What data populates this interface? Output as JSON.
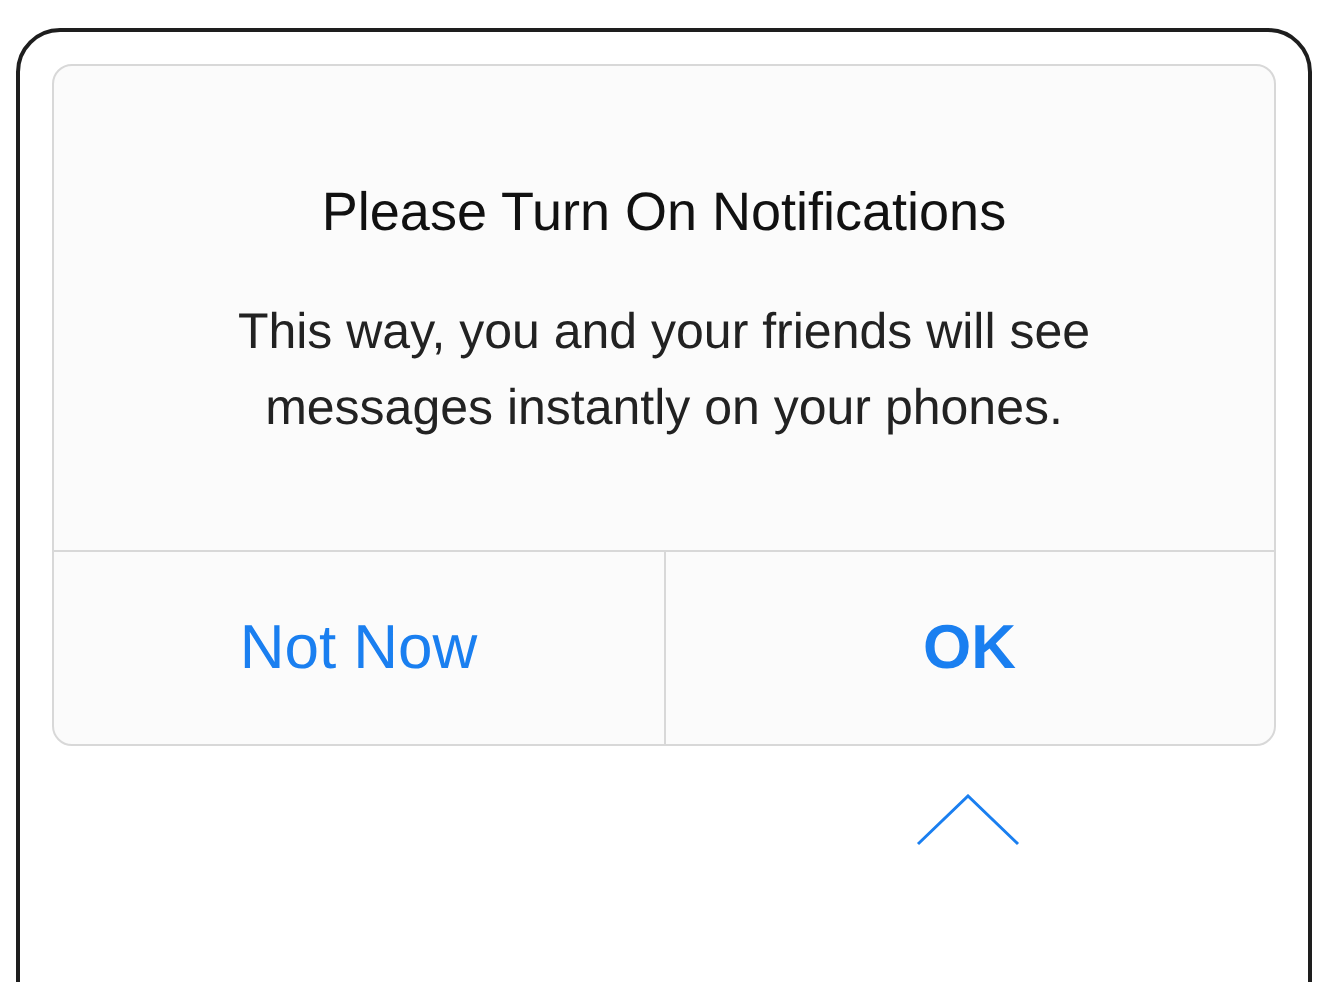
{
  "alert": {
    "title": "Please Turn On Notifications",
    "message": "This way, you and your friends will see messages instantly on your phones.",
    "buttons": [
      {
        "label": "Not Now",
        "bold": false
      },
      {
        "label": "OK",
        "bold": true
      }
    ]
  }
}
